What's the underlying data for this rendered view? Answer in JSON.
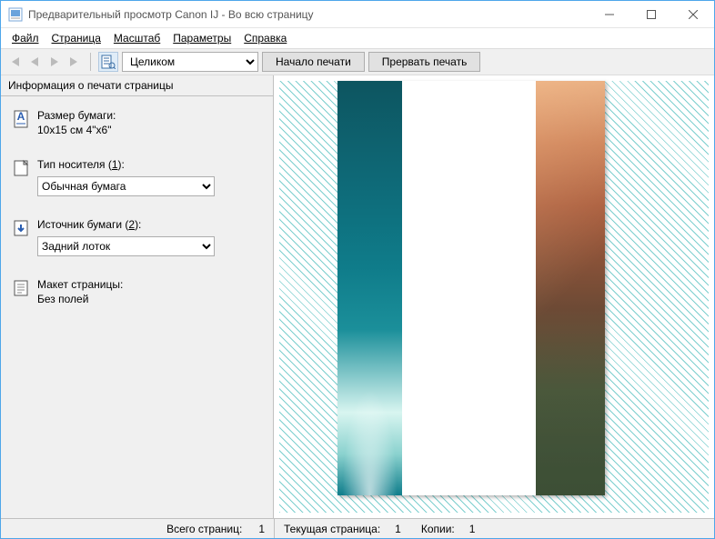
{
  "window": {
    "title": "Предварительный просмотр Canon IJ - Во всю страницу"
  },
  "menu": {
    "file": "Файл",
    "page": "Страница",
    "zoom": "Масштаб",
    "options": "Параметры",
    "help": "Справка"
  },
  "toolbar": {
    "zoom_selected": "Целиком",
    "start_print": "Начало печати",
    "cancel_print": "Прервать печать"
  },
  "sidebar": {
    "header": "Информация о печати страницы",
    "paper_size": {
      "label": "Размер бумаги:",
      "value": "10x15 см 4\"x6\""
    },
    "media_type": {
      "label_pre": "Тип носителя (",
      "label_key": "1",
      "label_post": "):",
      "value": "Обычная бумага"
    },
    "paper_source": {
      "label_pre": "Источник бумаги (",
      "label_key": "2",
      "label_post": "):",
      "value": "Задний лоток"
    },
    "layout": {
      "label": "Макет страницы:",
      "value": "Без полей"
    }
  },
  "status": {
    "total_pages_label": "Всего страниц:",
    "total_pages_value": "1",
    "current_page_label": "Текущая страница:",
    "current_page_value": "1",
    "copies_label": "Копии:",
    "copies_value": "1"
  }
}
